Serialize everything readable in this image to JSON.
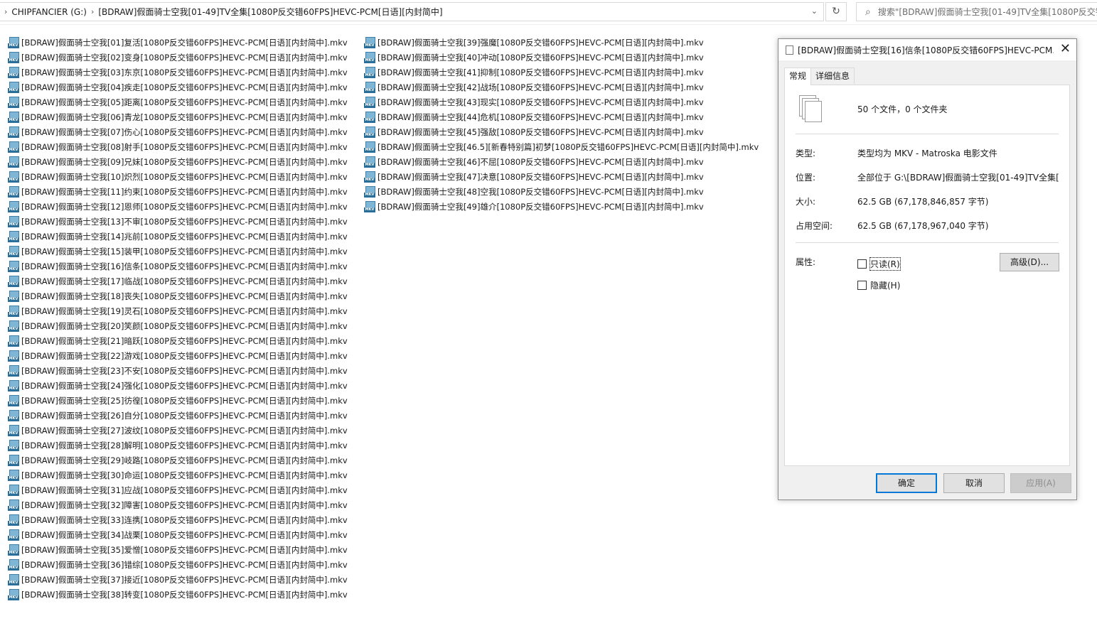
{
  "address_bar": {
    "segments": [
      "CHIPFANCIER (G:)",
      "[BDRAW]假面骑士空我[01-49]TV全集[1080P反交错60FPS]HEVC-PCM[日语][内封简中]"
    ],
    "search_placeholder": "搜索\"[BDRAW]假面骑士空我[01-49]TV全集[1080P反交错"
  },
  "files": {
    "icon_label": "MKV",
    "column1": [
      "[BDRAW]假面骑士空我[01]复活[1080P反交错60FPS]HEVC-PCM[日语][内封简中].mkv",
      "[BDRAW]假面骑士空我[02]变身[1080P反交错60FPS]HEVC-PCM[日语][内封简中].mkv",
      "[BDRAW]假面骑士空我[03]东京[1080P反交错60FPS]HEVC-PCM[日语][内封简中].mkv",
      "[BDRAW]假面骑士空我[04]疾走[1080P反交错60FPS]HEVC-PCM[日语][内封简中].mkv",
      "[BDRAW]假面骑士空我[05]距离[1080P反交错60FPS]HEVC-PCM[日语][内封简中].mkv",
      "[BDRAW]假面骑士空我[06]青龙[1080P反交错60FPS]HEVC-PCM[日语][内封简中].mkv",
      "[BDRAW]假面骑士空我[07]伤心[1080P反交错60FPS]HEVC-PCM[日语][内封简中].mkv",
      "[BDRAW]假面骑士空我[08]射手[1080P反交错60FPS]HEVC-PCM[日语][内封简中].mkv",
      "[BDRAW]假面骑士空我[09]兄妹[1080P反交错60FPS]HEVC-PCM[日语][内封简中].mkv",
      "[BDRAW]假面骑士空我[10]炽烈[1080P反交错60FPS]HEVC-PCM[日语][内封简中].mkv",
      "[BDRAW]假面骑士空我[11]约束[1080P反交错60FPS]HEVC-PCM[日语][内封简中].mkv",
      "[BDRAW]假面骑士空我[12]恩师[1080P反交错60FPS]HEVC-PCM[日语][内封简中].mkv",
      "[BDRAW]假面骑士空我[13]不审[1080P反交错60FPS]HEVC-PCM[日语][内封简中].mkv",
      "[BDRAW]假面骑士空我[14]兆前[1080P反交错60FPS]HEVC-PCM[日语][内封简中].mkv",
      "[BDRAW]假面骑士空我[15]装甲[1080P反交错60FPS]HEVC-PCM[日语][内封简中].mkv",
      "[BDRAW]假面骑士空我[16]信条[1080P反交错60FPS]HEVC-PCM[日语][内封简中].mkv",
      "[BDRAW]假面骑士空我[17]临战[1080P反交错60FPS]HEVC-PCM[日语][内封简中].mkv",
      "[BDRAW]假面骑士空我[18]丧失[1080P反交错60FPS]HEVC-PCM[日语][内封简中].mkv",
      "[BDRAW]假面骑士空我[19]灵石[1080P反交错60FPS]HEVC-PCM[日语][内封简中].mkv",
      "[BDRAW]假面骑士空我[20]笑颜[1080P反交错60FPS]HEVC-PCM[日语][内封简中].mkv",
      "[BDRAW]假面骑士空我[21]暗跃[1080P反交错60FPS]HEVC-PCM[日语][内封简中].mkv",
      "[BDRAW]假面骑士空我[22]游戏[1080P反交错60FPS]HEVC-PCM[日语][内封简中].mkv",
      "[BDRAW]假面骑士空我[23]不安[1080P反交错60FPS]HEVC-PCM[日语][内封简中].mkv",
      "[BDRAW]假面骑士空我[24]强化[1080P反交错60FPS]HEVC-PCM[日语][内封简中].mkv",
      "[BDRAW]假面骑士空我[25]彷徨[1080P反交错60FPS]HEVC-PCM[日语][内封简中].mkv",
      "[BDRAW]假面骑士空我[26]自分[1080P反交错60FPS]HEVC-PCM[日语][内封简中].mkv",
      "[BDRAW]假面骑士空我[27]波纹[1080P反交错60FPS]HEVC-PCM[日语][内封简中].mkv",
      "[BDRAW]假面骑士空我[28]解明[1080P反交错60FPS]HEVC-PCM[日语][内封简中].mkv",
      "[BDRAW]假面骑士空我[29]岐路[1080P反交错60FPS]HEVC-PCM[日语][内封简中].mkv",
      "[BDRAW]假面骑士空我[30]命运[1080P反交错60FPS]HEVC-PCM[日语][内封简中].mkv",
      "[BDRAW]假面骑士空我[31]应战[1080P反交错60FPS]HEVC-PCM[日语][内封简中].mkv",
      "[BDRAW]假面骑士空我[32]障害[1080P反交错60FPS]HEVC-PCM[日语][内封简中].mkv",
      "[BDRAW]假面骑士空我[33]连携[1080P反交错60FPS]HEVC-PCM[日语][内封简中].mkv",
      "[BDRAW]假面骑士空我[34]战栗[1080P反交错60FPS]HEVC-PCM[日语][内封简中].mkv",
      "[BDRAW]假面骑士空我[35]爱憎[1080P反交错60FPS]HEVC-PCM[日语][内封简中].mkv",
      "[BDRAW]假面骑士空我[36]错综[1080P反交错60FPS]HEVC-PCM[日语][内封简中].mkv",
      "[BDRAW]假面骑士空我[37]接近[1080P反交错60FPS]HEVC-PCM[日语][内封简中].mkv",
      "[BDRAW]假面骑士空我[38]转变[1080P反交错60FPS]HEVC-PCM[日语][内封简中].mkv"
    ],
    "column2": [
      "[BDRAW]假面骑士空我[39]强魔[1080P反交错60FPS]HEVC-PCM[日语][内封简中].mkv",
      "[BDRAW]假面骑士空我[40]冲动[1080P反交错60FPS]HEVC-PCM[日语][内封简中].mkv",
      "[BDRAW]假面骑士空我[41]抑制[1080P反交错60FPS]HEVC-PCM[日语][内封简中].mkv",
      "[BDRAW]假面骑士空我[42]战场[1080P反交错60FPS]HEVC-PCM[日语][内封简中].mkv",
      "[BDRAW]假面骑士空我[43]现实[1080P反交错60FPS]HEVC-PCM[日语][内封简中].mkv",
      "[BDRAW]假面骑士空我[44]危机[1080P反交错60FPS]HEVC-PCM[日语][内封简中].mkv",
      "[BDRAW]假面骑士空我[45]强敌[1080P反交错60FPS]HEVC-PCM[日语][内封简中].mkv",
      "[BDRAW]假面骑士空我[46.5][新春特别篇]初梦[1080P反交错60FPS]HEVC-PCM[日语][内封简中].mkv",
      "[BDRAW]假面骑士空我[46]不屈[1080P反交错60FPS]HEVC-PCM[日语][内封简中].mkv",
      "[BDRAW]假面骑士空我[47]决意[1080P反交错60FPS]HEVC-PCM[日语][内封简中].mkv",
      "[BDRAW]假面骑士空我[48]空我[1080P反交错60FPS]HEVC-PCM[日语][内封简中].mkv",
      "[BDRAW]假面骑士空我[49]雄介[1080P反交错60FPS]HEVC-PCM[日语][内封简中].mkv"
    ]
  },
  "dialog": {
    "title": "[BDRAW]假面骑士空我[16]信条[1080P反交错60FPS]HEVC-PCM...",
    "tabs": [
      "常规",
      "详细信息"
    ],
    "summary": "50 个文件，0 个文件夹",
    "type_label": "类型:",
    "type_value": "类型均为 MKV - Matroska 电影文件",
    "location_label": "位置:",
    "location_value": "全部位于 G:\\[BDRAW]假面骑士空我[01-49]TV全集[1",
    "size_label": "大小:",
    "size_value": "62.5 GB (67,178,846,857 字节)",
    "disk_label": "占用空间:",
    "disk_value": "62.5 GB (67,178,967,040 字节)",
    "attr_label": "属性:",
    "readonly_label": "只读(R)",
    "hidden_label": "隐藏(H)",
    "advanced_label": "高级(D)...",
    "ok_label": "确定",
    "cancel_label": "取消",
    "apply_label": "应用(A)"
  }
}
